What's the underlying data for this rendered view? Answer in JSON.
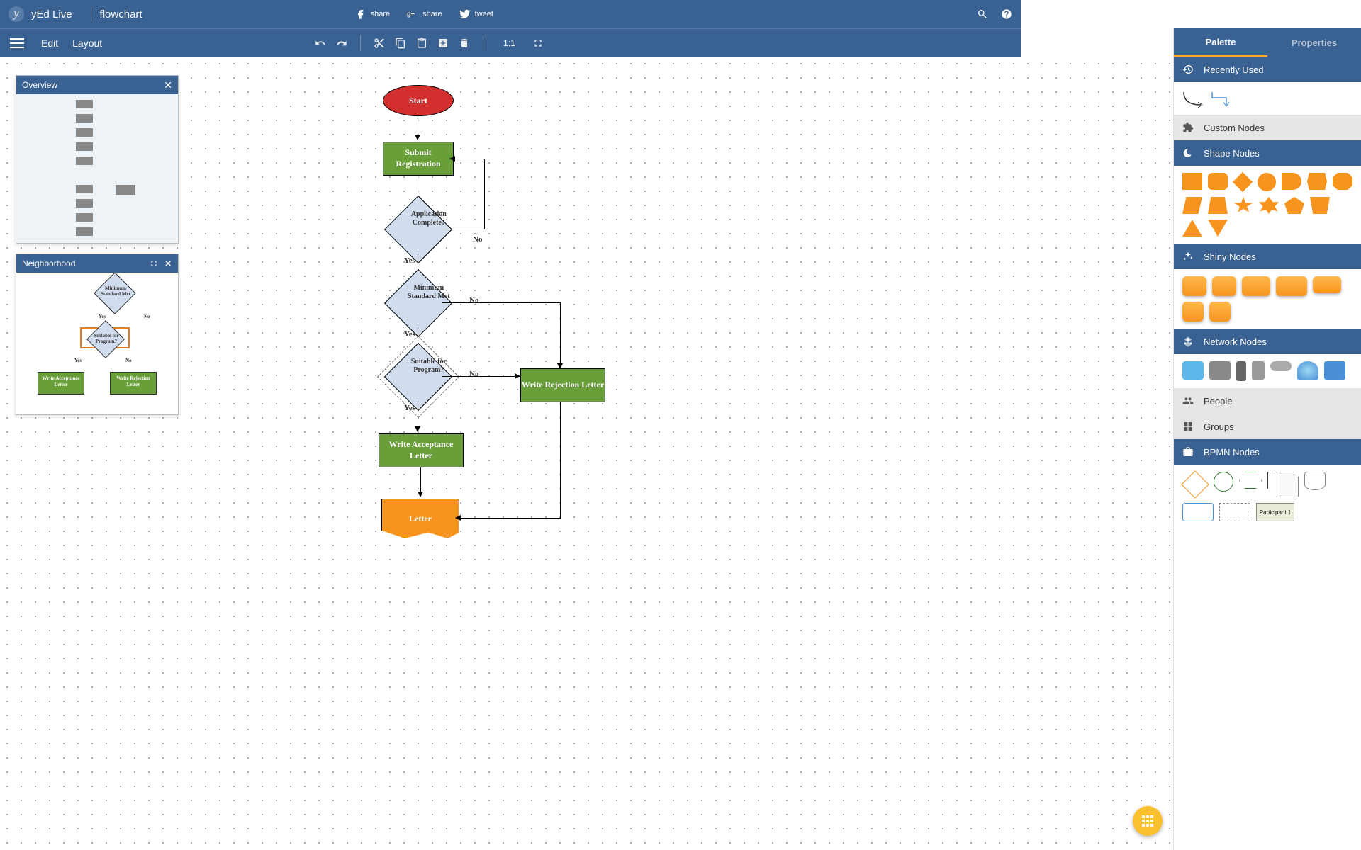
{
  "app": {
    "name": "yEd Live",
    "document": "flowchart"
  },
  "share": {
    "fb": "share",
    "gplus": "share",
    "tw": "tweet"
  },
  "menu": {
    "edit": "Edit",
    "layout": "Layout",
    "ratio": "1:1"
  },
  "panels": {
    "overview": {
      "title": "Overview"
    },
    "neighborhood": {
      "title": "Neighborhood",
      "nodes": {
        "top": "Minimum\nStandard\nMet",
        "mid": "Suitable for\nProgram?",
        "bl": "Write Acceptance\nLetter",
        "br": "Write Rejection\nLetter",
        "yes": "Yes",
        "no": "No"
      }
    }
  },
  "rightpanel": {
    "tabs": {
      "palette": "Palette",
      "properties": "Properties"
    },
    "sections": {
      "recent": "Recently Used",
      "custom": "Custom Nodes",
      "shape": "Shape Nodes",
      "shiny": "Shiny Nodes",
      "network": "Network Nodes",
      "people": "People",
      "groups": "Groups",
      "bpmn": "BPMN Nodes"
    },
    "bpmn_participant": "Participant 1"
  },
  "flowchart": {
    "start": "Start",
    "submit": "Submit Registration",
    "appcomplete": "Application Complete?",
    "minstd": "Minimum Standard Met",
    "suitable": "Suitable for Program?",
    "accept": "Write Acceptance Letter",
    "reject": "Write Rejection Letter",
    "letter": "Letter",
    "yes": "Yes",
    "no": "No"
  }
}
